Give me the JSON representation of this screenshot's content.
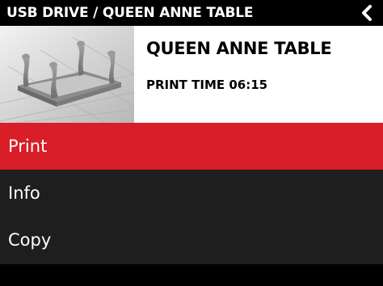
{
  "header": {
    "breadcrumb": "USB DRIVE / QUEEN ANNE TABLE",
    "back_icon": "chevron-left-icon"
  },
  "file": {
    "title": "QUEEN ANNE TABLE",
    "print_time": "PRINT TIME 06:15",
    "thumbnail_icon": "model-preview-table"
  },
  "menu": {
    "items": [
      {
        "label": "Print",
        "selected": true
      },
      {
        "label": "Info",
        "selected": false
      },
      {
        "label": "Copy",
        "selected": false
      }
    ]
  },
  "colors": {
    "header_bg": "#000000",
    "menu_bg": "#1e1e1e",
    "selected_bg": "#d81e26",
    "panel_bg": "#ffffff"
  }
}
